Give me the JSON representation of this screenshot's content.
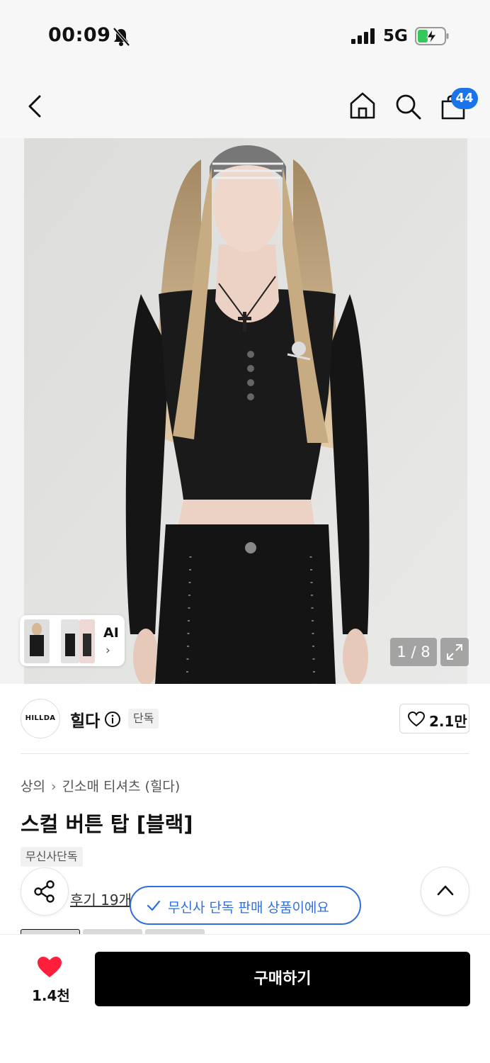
{
  "status_bar": {
    "time": "00:09",
    "network": "5G",
    "icons": [
      "bell-off-icon",
      "cellular-signal-icon",
      "battery-charging-icon"
    ]
  },
  "nav": {
    "icons": [
      "back-chevron-icon",
      "home-icon",
      "search-icon",
      "shopping-bag-icon"
    ],
    "cart_count": "44"
  },
  "gallery": {
    "ai_label": "AI",
    "ai_chevron": "›",
    "counter": "1 / 8",
    "icons": [
      "expand-icon"
    ]
  },
  "brand": {
    "logo_text": "HILLDA",
    "name": "힐다",
    "tag": "단독",
    "likes": "2.1만",
    "icons": [
      "info-icon",
      "heart-outline-icon"
    ]
  },
  "product": {
    "category": "상의",
    "subcategory": "긴소매 티셔츠 (힐다)",
    "title": "스컬 버튼 탑 [블랙]",
    "badge": "무신사단독"
  },
  "floating": {
    "review_text": "후기 19개",
    "toast": "무신사 단독 판매 상품이에요",
    "icons": [
      "share-icon",
      "check-icon",
      "chevron-up-icon"
    ]
  },
  "bottom_bar": {
    "wish_count": "1.4천",
    "buy_label": "구매하기",
    "heart_color": "#ff1e3c"
  },
  "colors": {
    "accent_blue": "#2f6fe0",
    "badge_blue": "#1a73e8",
    "buy_button": "#000000"
  }
}
